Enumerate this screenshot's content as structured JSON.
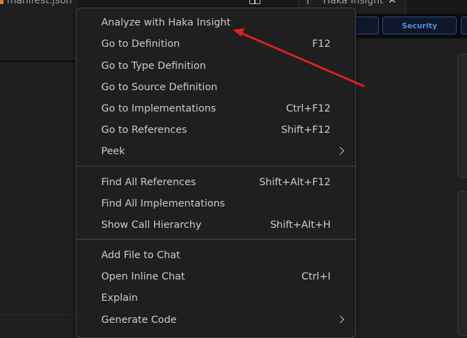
{
  "editor": {
    "tabs": [
      {
        "label": "manifest.json"
      },
      {
        "label": "Haka Insight"
      }
    ],
    "header_buttons": [
      {
        "label": ""
      },
      {
        "label": "Security"
      }
    ]
  },
  "context_menu": {
    "groups": [
      [
        {
          "label": "Analyze with Haka Insight",
          "shortcut": ""
        },
        {
          "label": "Go to Definition",
          "shortcut": "F12"
        },
        {
          "label": "Go to Type Definition",
          "shortcut": ""
        },
        {
          "label": "Go to Source Definition",
          "shortcut": ""
        },
        {
          "label": "Go to Implementations",
          "shortcut": "Ctrl+F12"
        },
        {
          "label": "Go to References",
          "shortcut": "Shift+F12"
        },
        {
          "label": "Peek",
          "shortcut": "",
          "submenu": true
        }
      ],
      [
        {
          "label": "Find All References",
          "shortcut": "Shift+Alt+F12"
        },
        {
          "label": "Find All Implementations",
          "shortcut": ""
        },
        {
          "label": "Show Call Hierarchy",
          "shortcut": "Shift+Alt+H"
        }
      ],
      [
        {
          "label": "Add File to Chat",
          "shortcut": ""
        },
        {
          "label": "Open Inline Chat",
          "shortcut": "Ctrl+I"
        },
        {
          "label": "Explain",
          "shortcut": ""
        },
        {
          "label": "Generate Code",
          "shortcut": "",
          "submenu": true
        }
      ]
    ]
  },
  "colors": {
    "annotation_arrow": "#e01f1f",
    "menu_background": "#1f1f1f",
    "menu_border": "#454545",
    "menu_text": "#cccccc",
    "accent_blue": "#5b8edb",
    "file_icon_orange": "#e37933"
  },
  "icons": {
    "split_editor": "split-editor-icon",
    "tab_close": "close-icon",
    "haka_logo": "haka-logo-icon",
    "submenu": "chevron-right-icon",
    "annotation": "arrow-annotation-icon"
  }
}
